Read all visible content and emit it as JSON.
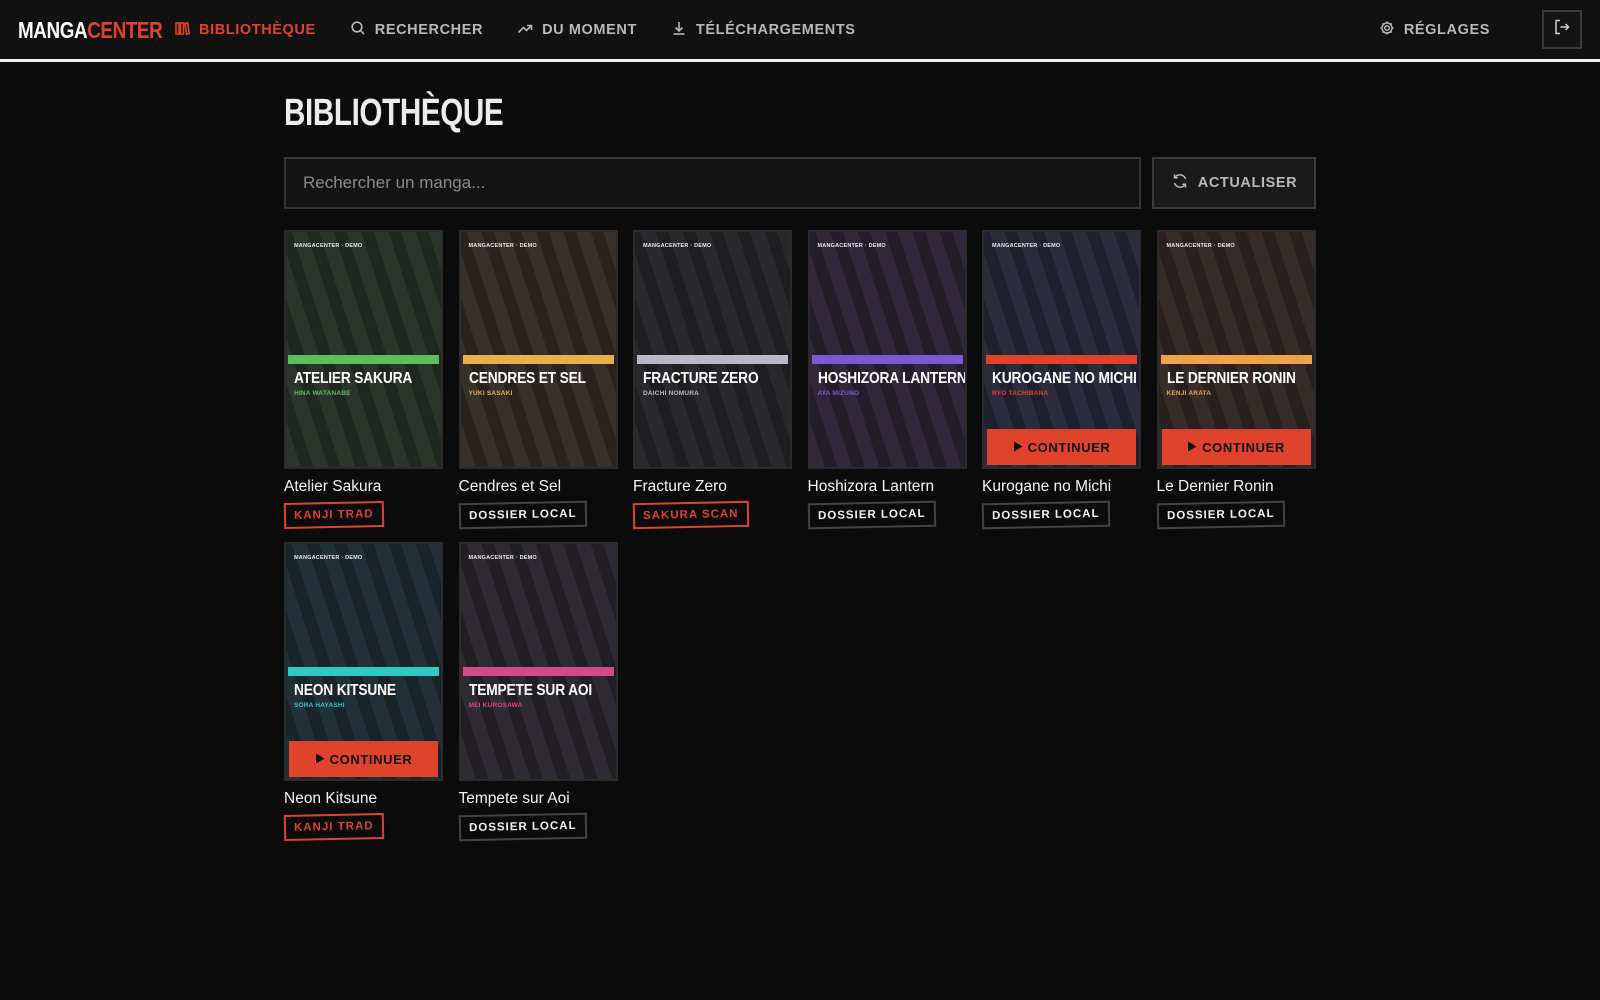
{
  "brand": {
    "part1": "MANGA",
    "part2": "CENTER"
  },
  "nav": {
    "items": [
      {
        "label": "BIBLIOTHÈQUE",
        "icon": "library-icon",
        "active": true
      },
      {
        "label": "RECHERCHER",
        "icon": "search-icon",
        "active": false
      },
      {
        "label": "DU MOMENT",
        "icon": "trending-icon",
        "active": false
      },
      {
        "label": "TÉLÉCHARGEMENTS",
        "icon": "download-icon",
        "active": false
      }
    ],
    "settings_label": "RÉGLAGES",
    "logout_icon": "logout-icon"
  },
  "page": {
    "title": "BIBLIOTHÈQUE",
    "search_placeholder": "Rechercher un manga...",
    "refresh_label": "ACTUALISER"
  },
  "colors": {
    "accent": "#e0432b",
    "background": "#0b0b0b"
  },
  "cover_tag": "MANGACENTER · DEMO",
  "continue_label": "CONTINUER",
  "mangas": [
    {
      "name": "Atelier Sakura",
      "cover_title": "ATELIER SAKURA",
      "author": "HINA WATANABE",
      "bg": "#2c352c",
      "accent": "#5cbf5e",
      "source": "KANJI TRAD",
      "source_style": "red",
      "continue": false
    },
    {
      "name": "Cendres et Sel",
      "cover_title": "CENDRES ET SEL",
      "author": "YUKI SASAKI",
      "bg": "#38302a",
      "accent": "#e8b04a",
      "source": "DOSSIER LOCAL",
      "source_style": "white",
      "continue": false
    },
    {
      "name": "Fracture Zero",
      "cover_title": "FRACTURE ZERO",
      "author": "DAICHI NOMURA",
      "bg": "#29292d",
      "accent": "#b9b9c4",
      "source": "SAKURA SCAN",
      "source_style": "red",
      "continue": false
    },
    {
      "name": "Hoshizora Lantern",
      "cover_title": "HOSHIZORA LANTERN",
      "author": "AYA MIZUNO",
      "bg": "#30283a",
      "accent": "#7a5ad0",
      "source": "DOSSIER LOCAL",
      "source_style": "white",
      "continue": false
    },
    {
      "name": "Kurogane no Michi",
      "cover_title": "KUROGANE NO MICHI",
      "author": "RYO TACHIBANA",
      "bg": "#2b2d3e",
      "accent": "#e0432b",
      "source": "DOSSIER LOCAL",
      "source_style": "white",
      "continue": true
    },
    {
      "name": "Le Dernier Ronin",
      "cover_title": "LE DERNIER RONIN",
      "author": "KENJI ARATA",
      "bg": "#372c2a",
      "accent": "#f0a24a",
      "source": "DOSSIER LOCAL",
      "source_style": "white",
      "continue": true
    },
    {
      "name": "Neon Kitsune",
      "cover_title": "NEON KITSUNE",
      "author": "SORA HAYASHI",
      "bg": "#22303a",
      "accent": "#30c9c4",
      "source": "KANJI TRAD",
      "source_style": "red",
      "continue": true
    },
    {
      "name": "Tempete sur Aoi",
      "cover_title": "TEMPETE SUR AOI",
      "author": "MEI KUROSAWA",
      "bg": "#2f2b32",
      "accent": "#d44a86",
      "source": "DOSSIER LOCAL",
      "source_style": "white",
      "continue": false
    }
  ]
}
